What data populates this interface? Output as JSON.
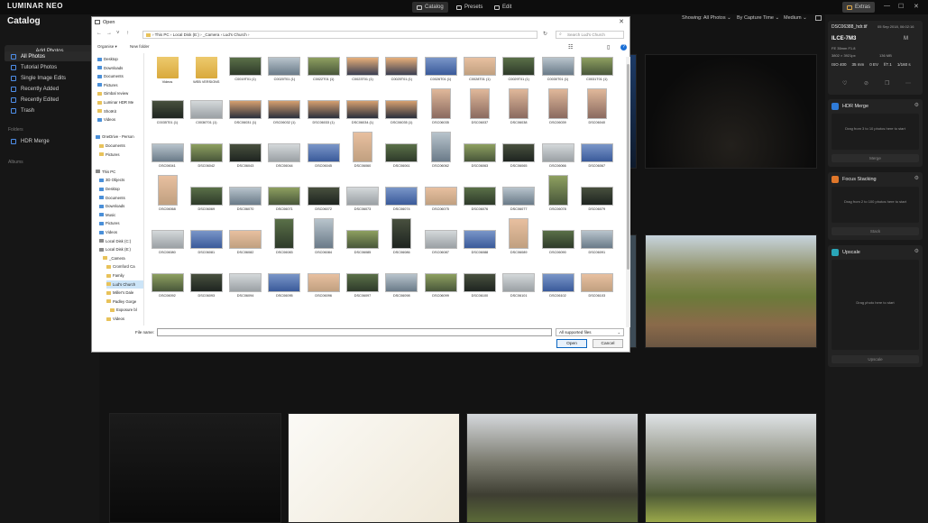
{
  "app": {
    "logo": "LUMINAR NEO",
    "tabs": [
      {
        "label": "Catalog",
        "active": true
      },
      {
        "label": "Presets",
        "active": false
      },
      {
        "label": "Edit",
        "active": false
      }
    ],
    "window_controls": [
      "—",
      "☐",
      "✕"
    ]
  },
  "sidebar": {
    "title": "Catalog",
    "add_photos": "Add Photos",
    "items": [
      {
        "label": "All Photos",
        "active": true
      },
      {
        "label": "Tutorial Photos",
        "active": false
      },
      {
        "label": "Single Image Edits",
        "active": false
      },
      {
        "label": "Recently Added",
        "active": false
      },
      {
        "label": "Recently Edited",
        "active": false
      },
      {
        "label": "Trash",
        "active": false
      }
    ],
    "folders_label": "Folders",
    "folders": [
      "HDR Merge"
    ],
    "albums_label": "Albums"
  },
  "toolbar": {
    "showing": "Showing: All Photos ⌄",
    "sort": "By Capture Time ⌄",
    "size": "Medium ⌄",
    "extras": "Extras"
  },
  "info": {
    "filename": "DSC06388_hdr.tif",
    "date": "05 Sep 2018, 06:02:16",
    "camera": "ILCE-7M3",
    "camera_badge": "M",
    "lens": "FE 35mm F1.8",
    "dimensions": "3802 × 3921px",
    "filesize": "136 MB",
    "iso": "ISO 400",
    "focal": "35 mm",
    "ev": "0 EV",
    "aperture": "f/7.1",
    "shutter": "1/160 s"
  },
  "panels": [
    {
      "name": "HDR Merge",
      "color": "#2f7bd8",
      "hint": "Drag from 3 to 10 photos here to start",
      "button": "Merge"
    },
    {
      "name": "Focus Stacking",
      "color": "#e0772a",
      "hint": "Drag from 2 to 100 photos here to start",
      "button": "Stack"
    },
    {
      "name": "Upscale",
      "color": "#2aa6b8",
      "hint": "Drag photo here to start",
      "button": "Upscale"
    }
  ],
  "dialog": {
    "title": "Open",
    "path": "› This PC › Local Disk (E:) › _Camera › Lud's Church ›",
    "search_placeholder": "Search Lud's Church",
    "organise": "Organise ▾",
    "new_folder": "New folder",
    "tree": [
      {
        "label": "Desktop",
        "type": "b",
        "indent": 2
      },
      {
        "label": "Downloads",
        "type": "b",
        "indent": 2
      },
      {
        "label": "Documents",
        "type": "b",
        "indent": 2
      },
      {
        "label": "Pictures",
        "type": "b",
        "indent": 2
      },
      {
        "label": "Gimbal review",
        "type": "i",
        "indent": 2
      },
      {
        "label": "Luminar HDR Me",
        "type": "i",
        "indent": 2
      },
      {
        "label": "ShotKit",
        "type": "i",
        "indent": 2
      },
      {
        "label": "Videos",
        "type": "b",
        "indent": 2
      },
      {
        "label": "",
        "type": "",
        "indent": 0
      },
      {
        "label": "OneDrive - Person",
        "type": "b",
        "indent": 0
      },
      {
        "label": "Documents",
        "type": "i",
        "indent": 4
      },
      {
        "label": "Pictures",
        "type": "i",
        "indent": 4
      },
      {
        "label": "",
        "type": "",
        "indent": 0
      },
      {
        "label": "This PC",
        "type": "d",
        "indent": 0
      },
      {
        "label": "3D Objects",
        "type": "b",
        "indent": 4
      },
      {
        "label": "Desktop",
        "type": "b",
        "indent": 4
      },
      {
        "label": "Documents",
        "type": "b",
        "indent": 4
      },
      {
        "label": "Downloads",
        "type": "b",
        "indent": 4
      },
      {
        "label": "Music",
        "type": "b",
        "indent": 4
      },
      {
        "label": "Pictures",
        "type": "b",
        "indent": 4
      },
      {
        "label": "Videos",
        "type": "b",
        "indent": 4
      },
      {
        "label": "Local Disk (C:)",
        "type": "d",
        "indent": 4
      },
      {
        "label": "Local Disk (E:)",
        "type": "d",
        "indent": 4
      },
      {
        "label": "_Camera",
        "type": "i",
        "indent": 8
      },
      {
        "label": "Cromford Ca",
        "type": "i",
        "indent": 12
      },
      {
        "label": "Family",
        "type": "i",
        "indent": 12
      },
      {
        "label": "Lud's Church",
        "type": "i",
        "indent": 12,
        "selected": true
      },
      {
        "label": "Miller's Dale",
        "type": "i",
        "indent": 12
      },
      {
        "label": "Padley Gorge",
        "type": "i",
        "indent": 12
      },
      {
        "label": "Exposure bl",
        "type": "i",
        "indent": 16
      },
      {
        "label": "Videos",
        "type": "i",
        "indent": 12
      },
      {
        "label": "ShotKit",
        "type": "i",
        "indent": 8
      }
    ],
    "thumbnails": [
      [
        "Videos",
        "WEB VERSIONS",
        "C0019T01 (1)",
        "C0020T01 (1)",
        "C0022T01 (1)",
        "C0023T01 (1)",
        "C0025T01 (1)",
        "C0026T01 (1)",
        "C0028T01 (1)",
        "C0029T01 (1)",
        "C0030T01 (1)",
        "C0031T01 (1)"
      ],
      [
        "C0035T01 (1)",
        "C0036T01 (1)",
        "DSC06031 (1)",
        "DSC06032 (1)",
        "DSC06033 (1)",
        "DSC06034 (1)",
        "DSC06035 (1)",
        "DSC06035",
        "DSC06037",
        "DSC06038",
        "DSC06039",
        "DSC06040"
      ],
      [
        "DSC06041",
        "DSC06042",
        "DSC06043",
        "DSC06044",
        "DSC06045",
        "DSC06060",
        "DSC06061",
        "DSC06062",
        "DSC06063",
        "DSC06065",
        "DSC06066",
        "DSC06067"
      ],
      [
        "DSC06068",
        "DSC06069",
        "DSC06070",
        "DSC06071",
        "DSC06072",
        "DSC06073",
        "DSC06074",
        "DSC06075",
        "DSC06076",
        "DSC06077",
        "DSC06078",
        "DSC06079"
      ],
      [
        "DSC06080",
        "DSC06081",
        "DSC06082",
        "DSC06083",
        "DSC06084",
        "DSC06085",
        "DSC06086",
        "DSC06087",
        "DSC06088",
        "DSC06089",
        "DSC06090",
        "DSC06091"
      ],
      [
        "DSC06092",
        "DSC06093",
        "DSC06094",
        "DSC06095",
        "DSC06096",
        "DSC06097",
        "DSC06098",
        "DSC06099",
        "DSC06100",
        "DSC06101",
        "DSC06102",
        "DSC06103"
      ]
    ],
    "file_name_label": "File name:",
    "file_name_value": "",
    "file_type": "All supported files",
    "open": "Open",
    "cancel": "Cancel"
  }
}
